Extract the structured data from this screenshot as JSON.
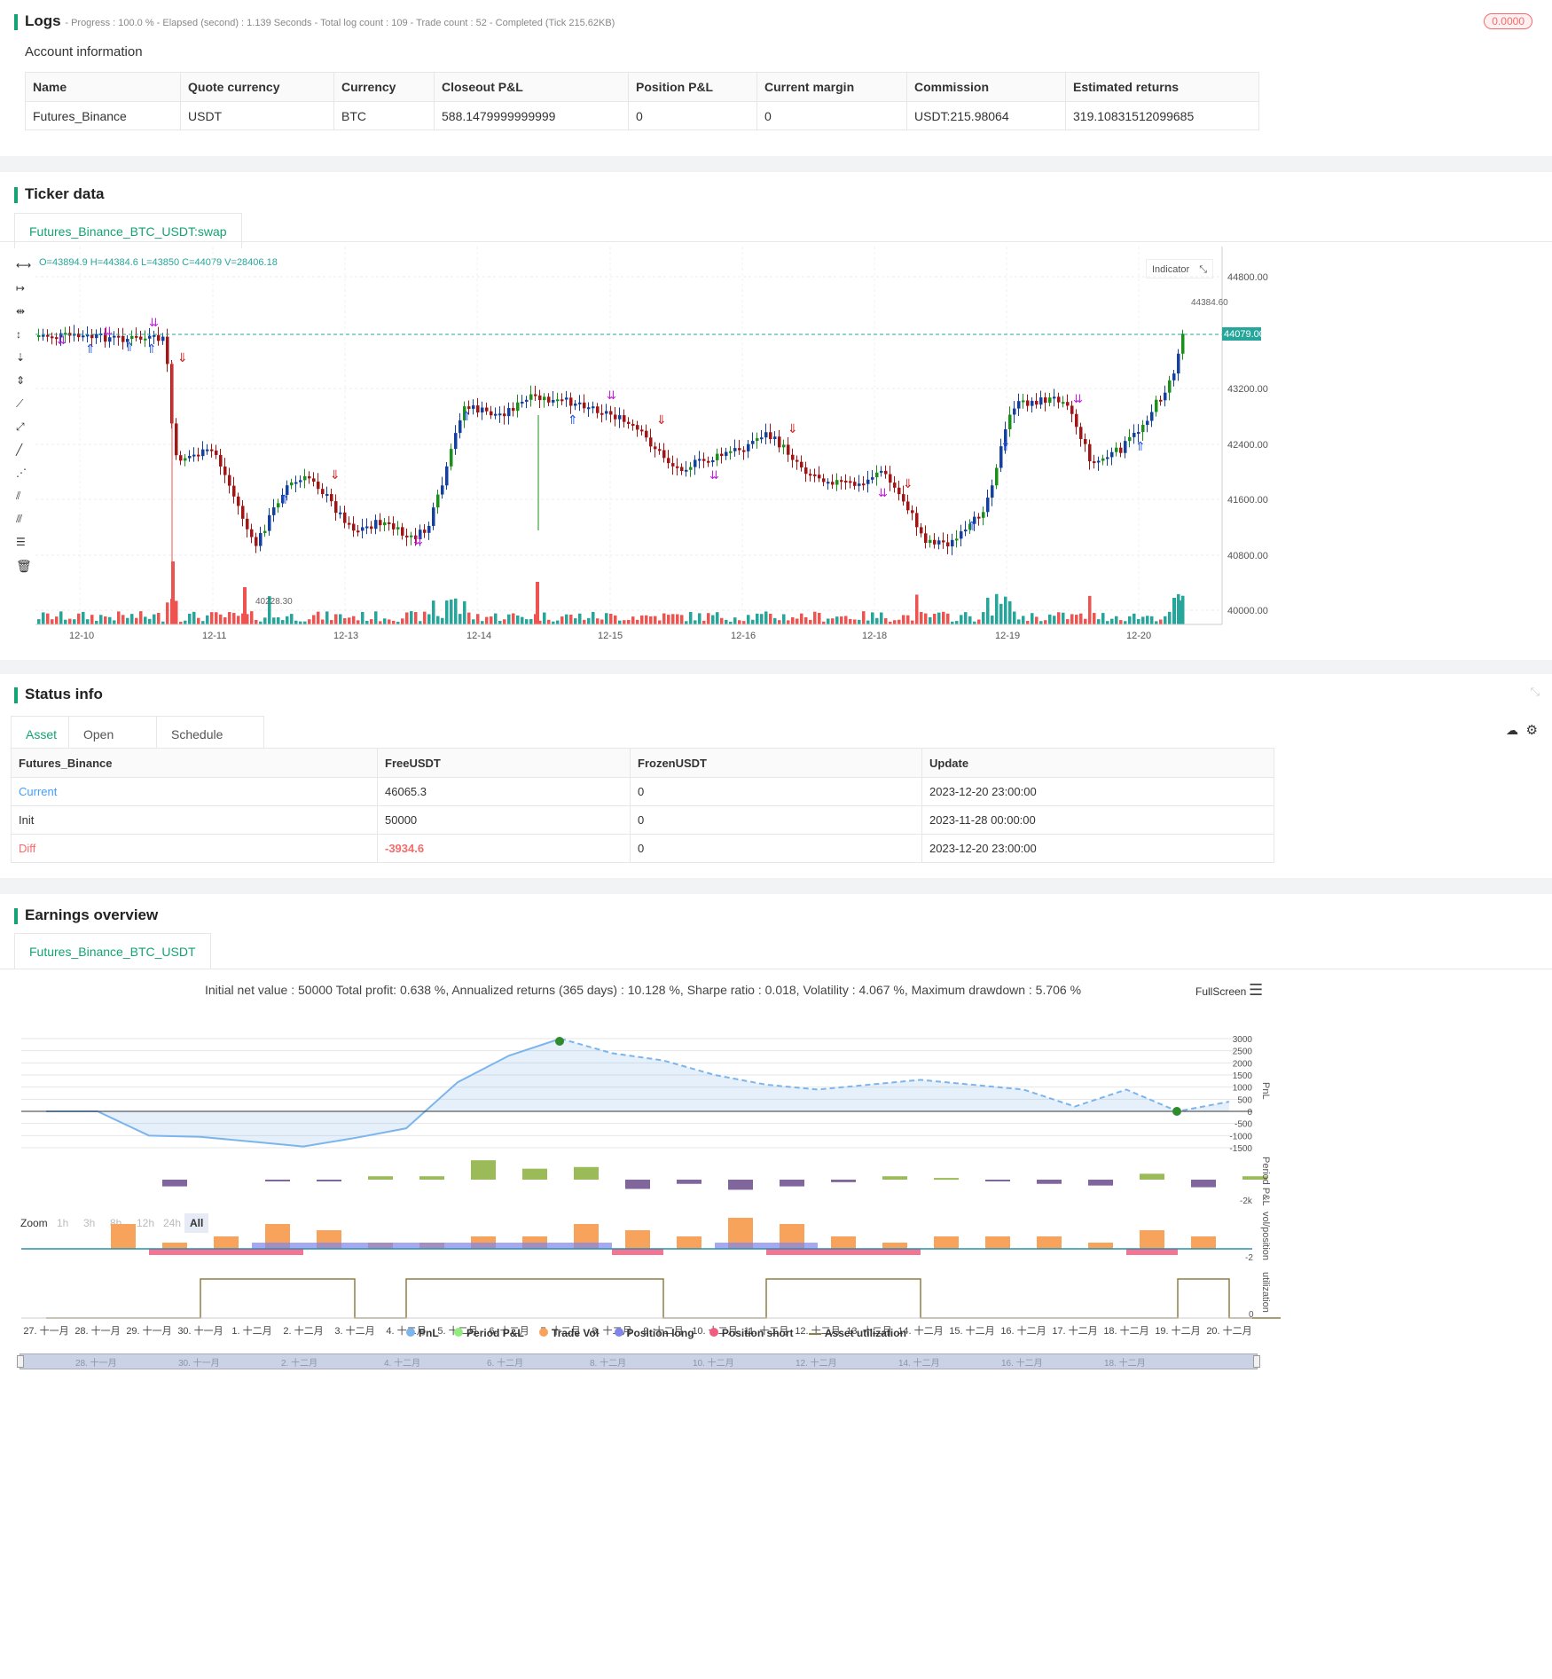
{
  "logs": {
    "title": "Logs",
    "summary": "- Progress : 100.0 % - Elapsed (second) : 1.139  Seconds - Total log count : 109 - Trade count : 52 - Completed (Tick 215.62KB)",
    "badge": "0.0000"
  },
  "account": {
    "title": "Account information",
    "headers": [
      "Name",
      "Quote currency",
      "Currency",
      "Closeout P&L",
      "Position P&L",
      "Current margin",
      "Commission",
      "Estimated returns"
    ],
    "row": [
      "Futures_Binance",
      "USDT",
      "BTC",
      "588.1479999999999",
      "0",
      "0",
      "USDT:215.98064",
      "319.10831512099685"
    ]
  },
  "ticker": {
    "title": "Ticker data",
    "tab": "Futures_Binance_BTC_USDT:swap",
    "ohlc": "O=43894.9 H=44384.6 L=43850 C=44079 V=28406.18",
    "indicator_label": "Indicator",
    "price_ticks": [
      "44800.00",
      "43200.00",
      "42400.00",
      "41600.00",
      "40800.00",
      "40000.00"
    ],
    "current_price": "44079.00",
    "high_label": "44384.60",
    "low_label": "40228.30",
    "date_ticks": [
      "12-10",
      "12-11",
      "12-13",
      "12-14",
      "12-15",
      "12-16",
      "12-18",
      "12-19",
      "12-20"
    ]
  },
  "status": {
    "title": "Status info",
    "tabs": [
      "Asset",
      "Open orders",
      "Schedule orders"
    ],
    "headers": [
      "Futures_Binance",
      "FreeUSDT",
      "FrozenUSDT",
      "Update"
    ],
    "rows": [
      [
        "Current",
        "46065.3",
        "0",
        "2023-12-20 23:00:00"
      ],
      [
        "Init",
        "50000",
        "0",
        "2023-11-28 00:00:00"
      ],
      [
        "Diff",
        "-3934.6",
        "0",
        "2023-12-20 23:00:00"
      ]
    ]
  },
  "earnings": {
    "title": "Earnings overview",
    "tab": "Futures_Binance_BTC_USDT",
    "summary": "Initial net value : 50000 Total profit: 0.638 %, Annualized returns (365 days) : 10.128 %, Sharpe ratio : 0.018, Volatility : 4.067 %, Maximum drawdown : 5.706 %",
    "fullscreen": "FullScreen",
    "zoom_label": "Zoom",
    "zoom_options": [
      "1h",
      "3h",
      "8h",
      "12h",
      "24h",
      "All"
    ],
    "pnl_ticks": [
      "3000",
      "2500",
      "2000",
      "1500",
      "1000",
      "500",
      "0",
      "-500",
      "-1000",
      "-1500"
    ],
    "axis_titles": [
      "PnL",
      "Period P&L",
      "vol/position",
      "utilization"
    ],
    "period_tick": "-2k",
    "vol_tick": "-2",
    "util_tick": "0",
    "date_ticks": [
      "27. 十一月",
      "28. 十一月",
      "29. 十一月",
      "30. 十一月",
      "1. 十二月",
      "2. 十二月",
      "3. 十二月",
      "4. 十二月",
      "5. 十二月",
      "6. 十二月",
      "7. 十二月",
      "8. 十二月",
      "9. 十二月",
      "10. 十二月",
      "11. 十二月",
      "12. 十二月",
      "13. 十二月",
      "14. 十二月",
      "15. 十二月",
      "16. 十二月",
      "17. 十二月",
      "18. 十二月",
      "19. 十二月",
      "20. 十二月"
    ],
    "navigator_ticks": [
      "28. 十一月",
      "30. 十一月",
      "2. 十二月",
      "4. 十二月",
      "6. 十二月",
      "8. 十二月",
      "10. 十二月",
      "12. 十二月",
      "14. 十二月",
      "16. 十二月",
      "18. 十二月"
    ],
    "legend": [
      {
        "name": "PnL",
        "color": "#7cb5ec"
      },
      {
        "name": "Period P&L",
        "color": "#90ed7d"
      },
      {
        "name": "Trade Vol",
        "color": "#f7a35c"
      },
      {
        "name": "Position long",
        "color": "#8085e9"
      },
      {
        "name": "Position short",
        "color": "#f15c80"
      },
      {
        "name": "Asset utilization",
        "color": "#8d7e45"
      }
    ]
  },
  "chart_data": {
    "type": "line",
    "x": [
      "27. 十一月",
      "28. 十一月",
      "29. 十一月",
      "30. 十一月",
      "1. 十二月",
      "2. 十二月",
      "3. 十二月",
      "4. 十二月",
      "5. 十二月",
      "6. 十二月",
      "7. 十二月",
      "8. 十二月",
      "9. 十二月",
      "10. 十二月",
      "11. 十二月",
      "12. 十二月",
      "13. 十二月",
      "14. 十二月",
      "15. 十二月",
      "16. 十二月",
      "17. 十二月",
      "18. 十二月",
      "19. 十二月",
      "20. 十二月"
    ],
    "series": [
      {
        "name": "PnL",
        "values": [
          0,
          0,
          -1000,
          -1050,
          -1250,
          -1450,
          -1100,
          -700,
          1200,
          2300,
          3000,
          2400,
          2100,
          1500,
          1100,
          900,
          1100,
          1300,
          1100,
          900,
          200,
          900,
          0,
          400
        ]
      },
      {
        "name": "Period P&L",
        "values": [
          0,
          0,
          -800,
          0,
          -200,
          -200,
          400,
          400,
          2300,
          1300,
          1500,
          -1100,
          -500,
          -1200,
          -800,
          -300,
          400,
          200,
          -100,
          -500,
          -700,
          700,
          -900,
          400
        ]
      },
      {
        "name": "Trade Vol",
        "values": [
          0,
          2,
          0.5,
          1,
          2,
          1.5,
          0.5,
          0.5,
          1,
          1,
          2,
          1.5,
          1,
          2.5,
          2,
          1,
          0.5,
          1,
          1,
          1,
          0.5,
          1.5,
          1,
          0
        ]
      },
      {
        "name": "Position long",
        "values": [
          0,
          0,
          0,
          0,
          0.5,
          0.5,
          0.5,
          0.5,
          0.5,
          0.5,
          0.5,
          0,
          0,
          0.5,
          0.5,
          0,
          0,
          0,
          0,
          0,
          0,
          0,
          0,
          0
        ]
      },
      {
        "name": "Position short",
        "values": [
          0,
          0,
          -0.5,
          -0.5,
          -0.5,
          0,
          0,
          0,
          0,
          0,
          0,
          -0.5,
          0,
          0,
          -0.5,
          -0.5,
          -0.5,
          0,
          0,
          0,
          0,
          -0.5,
          0,
          0
        ]
      },
      {
        "name": "Asset utilization",
        "values": [
          0,
          0,
          0,
          1,
          1,
          1,
          0,
          1,
          1,
          1,
          1,
          1,
          0,
          0,
          1,
          1,
          1,
          0,
          0,
          0,
          0,
          0,
          1,
          0
        ]
      }
    ],
    "ylim": [
      -1500,
      3000
    ]
  }
}
